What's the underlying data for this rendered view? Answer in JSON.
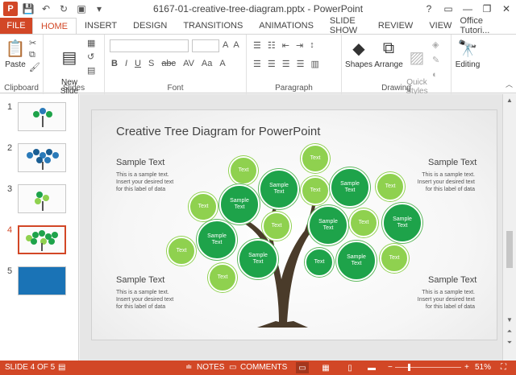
{
  "app": {
    "title": "6167-01-creative-tree-diagram.pptx - PowerPoint",
    "logo": "P",
    "user": "Office Tutori...",
    "accent": "#d24726"
  },
  "qat": {
    "save_icon": "save-icon",
    "undo_icon": "undo-icon",
    "redo_icon": "redo-icon",
    "present_icon": "present-icon"
  },
  "window": {
    "help": "?",
    "minimize": "—",
    "restore": "❐",
    "close": "✕"
  },
  "tabs": [
    "FILE",
    "HOME",
    "INSERT",
    "DESIGN",
    "TRANSITIONS",
    "ANIMATIONS",
    "SLIDE SHOW",
    "REVIEW",
    "VIEW"
  ],
  "ribbon": {
    "clipboard": {
      "label": "Clipboard",
      "paste": "Paste"
    },
    "slides": {
      "label": "Slides",
      "new_slide": "New\nSlide"
    },
    "font": {
      "label": "Font"
    },
    "paragraph": {
      "label": "Paragraph"
    },
    "drawing": {
      "label": "Drawing",
      "shapes": "Shapes",
      "arrange": "Arrange",
      "quick_styles": "Quick\nStyles"
    },
    "editing": {
      "label": "Editing"
    }
  },
  "thumbs": [
    "1",
    "2",
    "3",
    "4",
    "5"
  ],
  "slide": {
    "title": "Creative Tree Diagram for PowerPoint",
    "blocks": [
      {
        "head": "Sample Text",
        "body": "This is a sample text. Insert your desired text for this label of data"
      },
      {
        "head": "Sample Text",
        "body": "This is a sample text. Insert your desired text for this label of data"
      },
      {
        "head": "Sample Text",
        "body": "This is a sample text. Insert your desired text for this label of data"
      },
      {
        "head": "Sample Text",
        "body": "This is a sample text. Insert your desired text for this label of data"
      }
    ],
    "bubble_text": "Text",
    "bubble_big": "Sample\nText",
    "colors": {
      "dark_green": "#1ea34a",
      "light_green": "#8fd14f",
      "trunk": "#4a3b2a"
    }
  },
  "status": {
    "slide": "SLIDE 4 OF 5",
    "notes": "NOTES",
    "comments": "COMMENTS",
    "zoom_out": "−",
    "zoom_in": "+",
    "zoom": "51%"
  }
}
